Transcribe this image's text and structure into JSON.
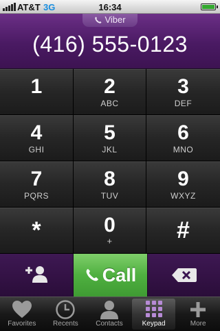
{
  "status_bar": {
    "carrier": "AT&T",
    "network": "3G",
    "time": "16:34",
    "battery_level": 1.0,
    "icons": [
      "signal-icon",
      "battery-icon"
    ]
  },
  "header": {
    "brand": "Viber",
    "number": "(416) 555-0123"
  },
  "keypad": {
    "keys": [
      {
        "digit": "1",
        "letters": ""
      },
      {
        "digit": "2",
        "letters": "ABC"
      },
      {
        "digit": "3",
        "letters": "DEF"
      },
      {
        "digit": "4",
        "letters": "GHI"
      },
      {
        "digit": "5",
        "letters": "JKL"
      },
      {
        "digit": "6",
        "letters": "MNO"
      },
      {
        "digit": "7",
        "letters": "PQRS"
      },
      {
        "digit": "8",
        "letters": "TUV"
      },
      {
        "digit": "9",
        "letters": "WXYZ"
      },
      {
        "digit": "*",
        "letters": ""
      },
      {
        "digit": "0",
        "letters": "+"
      },
      {
        "digit": "#",
        "letters": ""
      }
    ]
  },
  "actions": {
    "call_label": "Call",
    "icons": [
      "add-contact-icon",
      "phone-icon",
      "backspace-icon"
    ]
  },
  "tab_bar": {
    "tabs": [
      {
        "label": "Favorites",
        "icon": "heart-icon",
        "active": false
      },
      {
        "label": "Recents",
        "icon": "clock-icon",
        "active": false
      },
      {
        "label": "Contacts",
        "icon": "person-icon",
        "active": false
      },
      {
        "label": "Keypad",
        "icon": "keypad-icon",
        "active": true
      },
      {
        "label": "More",
        "icon": "plus-icon",
        "active": false
      }
    ]
  },
  "colors": {
    "brand_purple": "#4a1a63",
    "call_green": "#4fb040",
    "network_blue": "#1a8fe0"
  }
}
